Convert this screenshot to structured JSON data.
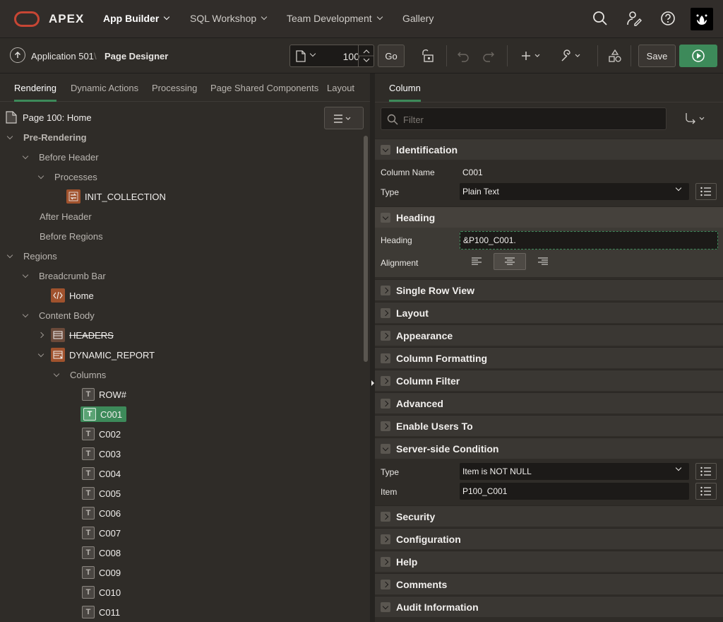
{
  "topnav": {
    "brand": "APEX",
    "items": [
      {
        "label": "App Builder"
      },
      {
        "label": "SQL Workshop"
      },
      {
        "label": "Team Development"
      },
      {
        "label": "Gallery"
      }
    ]
  },
  "toolbar": {
    "application": "Application 501",
    "separator": "\\",
    "page_designer": "Page Designer",
    "page_number": "100",
    "go_label": "Go",
    "save_label": "Save"
  },
  "left": {
    "tabs": [
      {
        "label": "Rendering"
      },
      {
        "label": "Dynamic Actions"
      },
      {
        "label": "Processing"
      },
      {
        "label": "Page Shared Components"
      },
      {
        "label": "Layout"
      }
    ],
    "tree": {
      "page": "Page 100: Home",
      "pre_rendering": "Pre-Rendering",
      "before_header": "Before Header",
      "processes": "Processes",
      "init_collection": "INIT_COLLECTION",
      "after_header": "After Header",
      "before_regions": "Before Regions",
      "regions": "Regions",
      "breadcrumb_bar": "Breadcrumb Bar",
      "home": "Home",
      "content_body": "Content Body",
      "headers": "HEADERS",
      "dynamic_report": "DYNAMIC_REPORT",
      "columns": "Columns",
      "cols": [
        "ROW#",
        "C001",
        "C002",
        "C003",
        "C004",
        "C005",
        "C006",
        "C007",
        "C008",
        "C009",
        "C010",
        "C011"
      ],
      "t_glyph": "T"
    }
  },
  "right": {
    "tab": "Column",
    "filter_placeholder": "Filter",
    "identification": {
      "title": "Identification",
      "column_name_label": "Column Name",
      "column_name": "C001",
      "type_label": "Type",
      "type": "Plain Text"
    },
    "heading": {
      "title": "Heading",
      "heading_label": "Heading",
      "heading": "&P100_C001.",
      "alignment_label": "Alignment"
    },
    "sections": [
      "Single Row View",
      "Layout",
      "Appearance",
      "Column Formatting",
      "Column Filter",
      "Advanced",
      "Enable Users To"
    ],
    "condition": {
      "title": "Server-side Condition",
      "type_label": "Type",
      "type": "Item is NOT NULL",
      "item_label": "Item",
      "item": "P100_C001"
    },
    "sections2": [
      "Security",
      "Configuration",
      "Help",
      "Comments",
      "Audit Information"
    ]
  },
  "colors": {
    "accent": "#3d8a5a",
    "brand": "#c74634"
  }
}
